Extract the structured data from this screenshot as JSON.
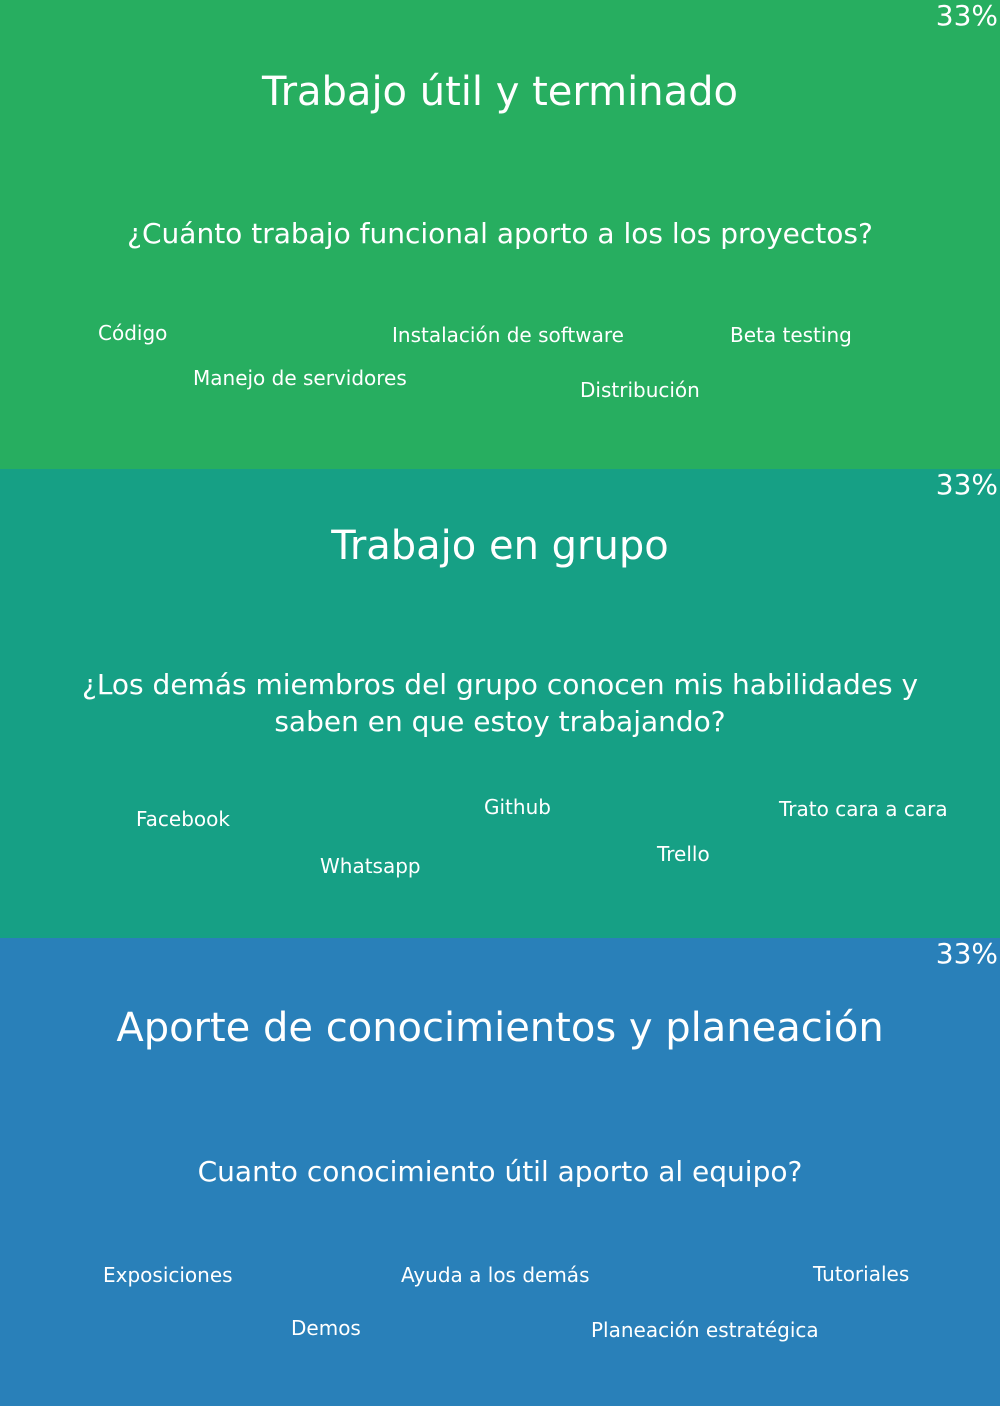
{
  "sections": [
    {
      "percent": "33%",
      "title": "Trabajo útil y terminado",
      "question": "¿Cuánto trabajo funcional aporto a los los proyectos?",
      "tags": [
        "Código",
        "Instalación de software",
        "Beta testing",
        "Manejo de servidores",
        "Distribución"
      ],
      "background": "#27ae60"
    },
    {
      "percent": "33%",
      "title": "Trabajo en grupo",
      "question": "¿Los demás miembros del grupo conocen mis habilidades y saben en que estoy trabajando?",
      "tags": [
        "Facebook",
        "Github",
        "Trato cara a cara",
        "Whatsapp",
        "Trello"
      ],
      "background": "#16a085"
    },
    {
      "percent": "33%",
      "title": "Aporte de conocimientos y planeación",
      "question": "Cuanto conocimiento útil aporto al equipo?",
      "tags": [
        "Exposiciones",
        "Ayuda a los demás",
        "Tutoriales",
        "Demos",
        "Planeación estratégica"
      ],
      "background": "#2980b9"
    }
  ]
}
